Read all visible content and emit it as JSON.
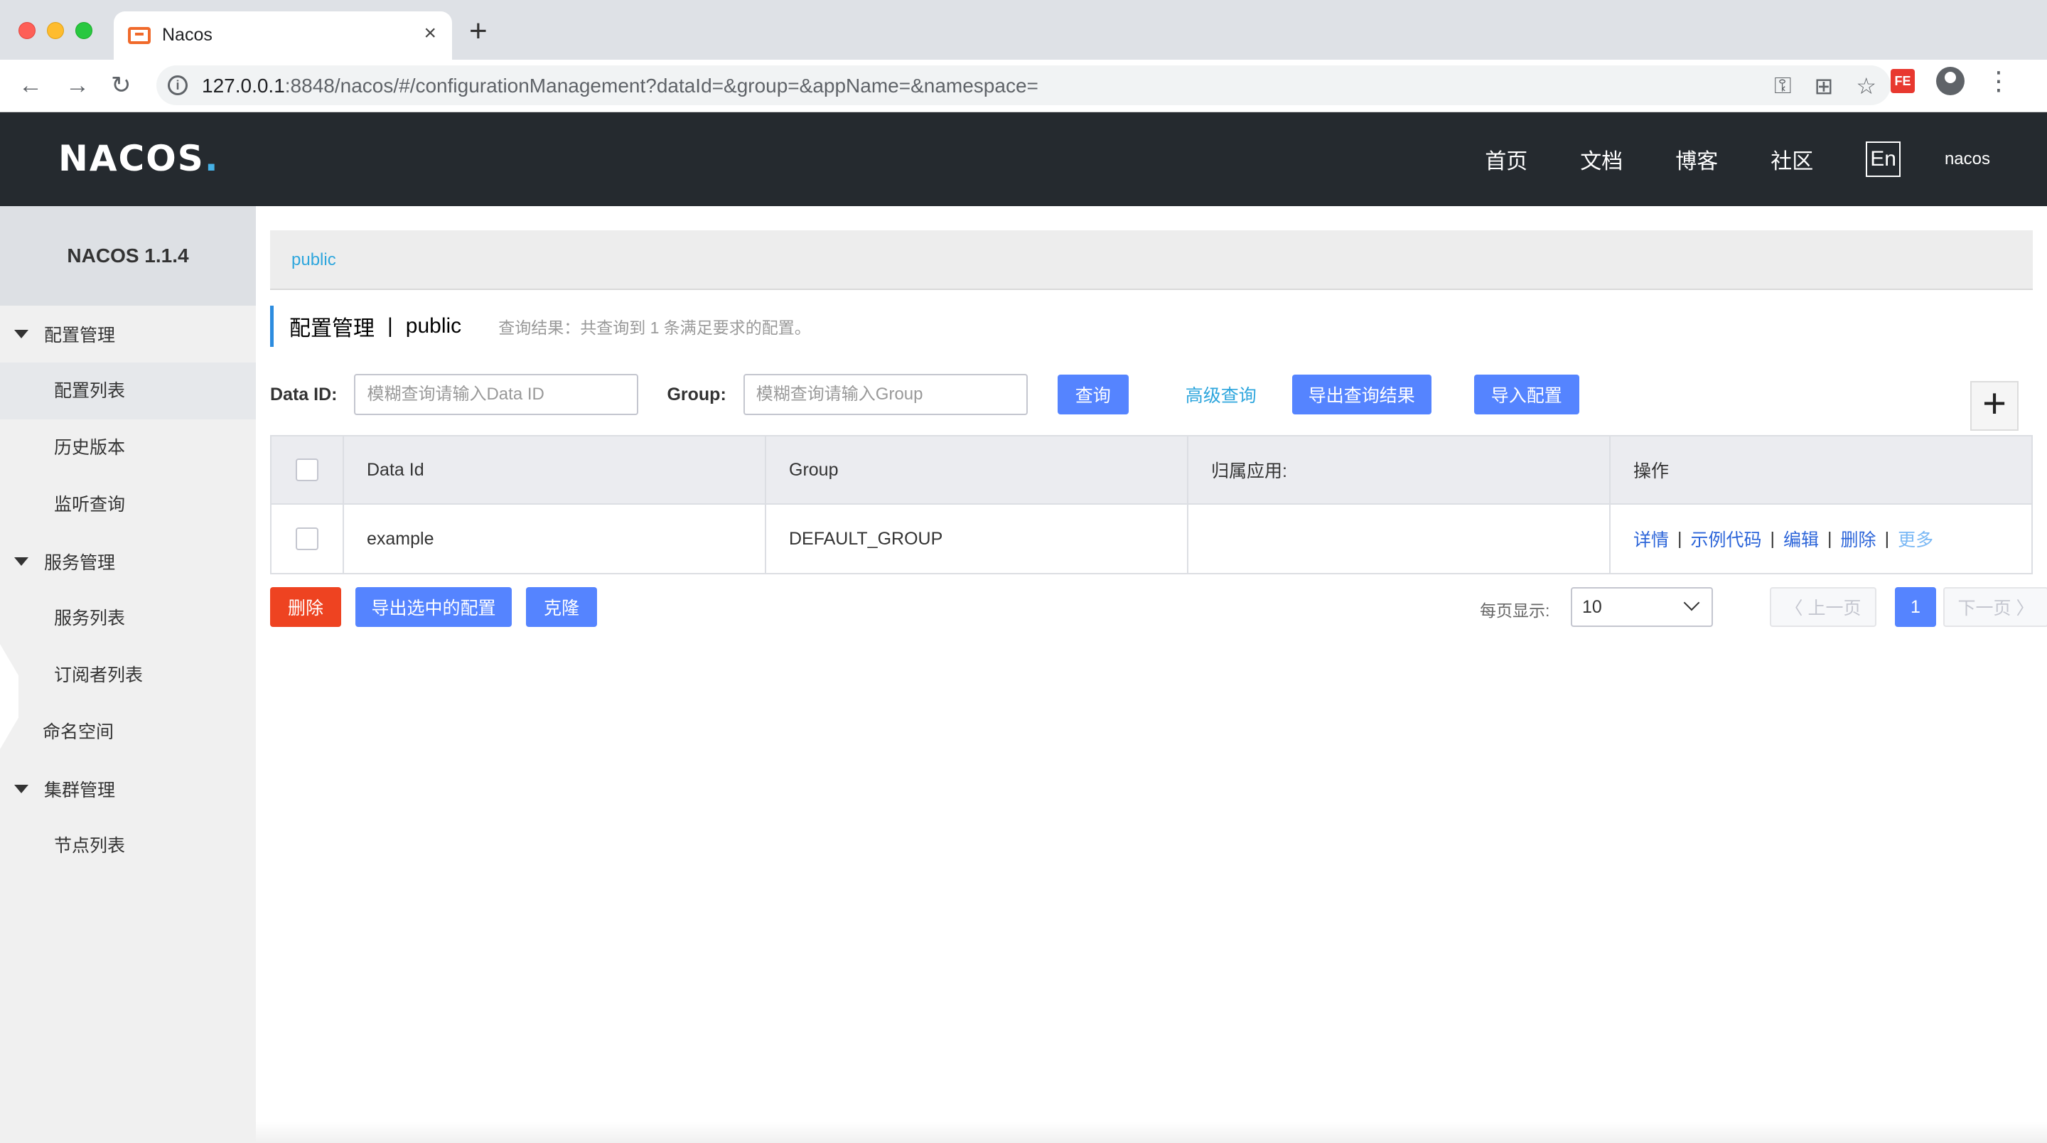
{
  "browser": {
    "tab_title": "Nacos",
    "tab_close": "×",
    "new_tab": "+",
    "url_host": "127.0.0.1",
    "url_rest": ":8848/nacos/#/configurationManagement?dataId=&group=&appName=&namespace=",
    "back": "←",
    "forward": "→",
    "reload": "↻",
    "fe_badge": "FE",
    "kebab": "⋮"
  },
  "header": {
    "logo_main": "NACOS",
    "logo_dot": ".",
    "nav": [
      "首页",
      "文档",
      "博客",
      "社区"
    ],
    "lang": "En",
    "user": "nacos"
  },
  "sidebar": {
    "version": "NACOS 1.1.4",
    "groups": [
      {
        "label": "配置管理",
        "items": [
          "配置列表",
          "历史版本",
          "监听查询"
        ]
      },
      {
        "label": "服务管理",
        "items": [
          "服务列表",
          "订阅者列表"
        ]
      }
    ],
    "namespace": "命名空间",
    "cluster": {
      "label": "集群管理",
      "items": [
        "节点列表"
      ]
    }
  },
  "main": {
    "namespace_link": "public",
    "title": "配置管理",
    "title_sep": "|",
    "title_ns": "public",
    "query_result": "查询结果：共查询到 1 条满足要求的配置。",
    "filters": {
      "data_id_label": "Data ID:",
      "data_id_placeholder": "模糊查询请输入Data ID",
      "group_label": "Group:",
      "group_placeholder": "模糊查询请输入Group",
      "query_btn": "查询",
      "advanced_link": "高级查询",
      "export_btn": "导出查询结果",
      "import_btn": "导入配置",
      "add_btn": "+"
    },
    "table": {
      "headers": [
        "Data Id",
        "Group",
        "归属应用:",
        "操作"
      ],
      "rows": [
        {
          "data_id": "example",
          "group": "DEFAULT_GROUP",
          "app": "",
          "ops": [
            "详情",
            "示例代码",
            "编辑",
            "删除"
          ],
          "more": "更多"
        }
      ]
    },
    "bottom": {
      "delete_btn": "删除",
      "export_selected_btn": "导出选中的配置",
      "clone_btn": "克隆",
      "page_size_label": "每页显示:",
      "page_size": "10",
      "prev": "〈 上一页",
      "page": "1",
      "next": "下一页 〉"
    }
  },
  "colors": {
    "header_bg": "#252a2f",
    "primary": "#5584ff",
    "danger": "#ee4321",
    "link": "#2ea6dd"
  }
}
